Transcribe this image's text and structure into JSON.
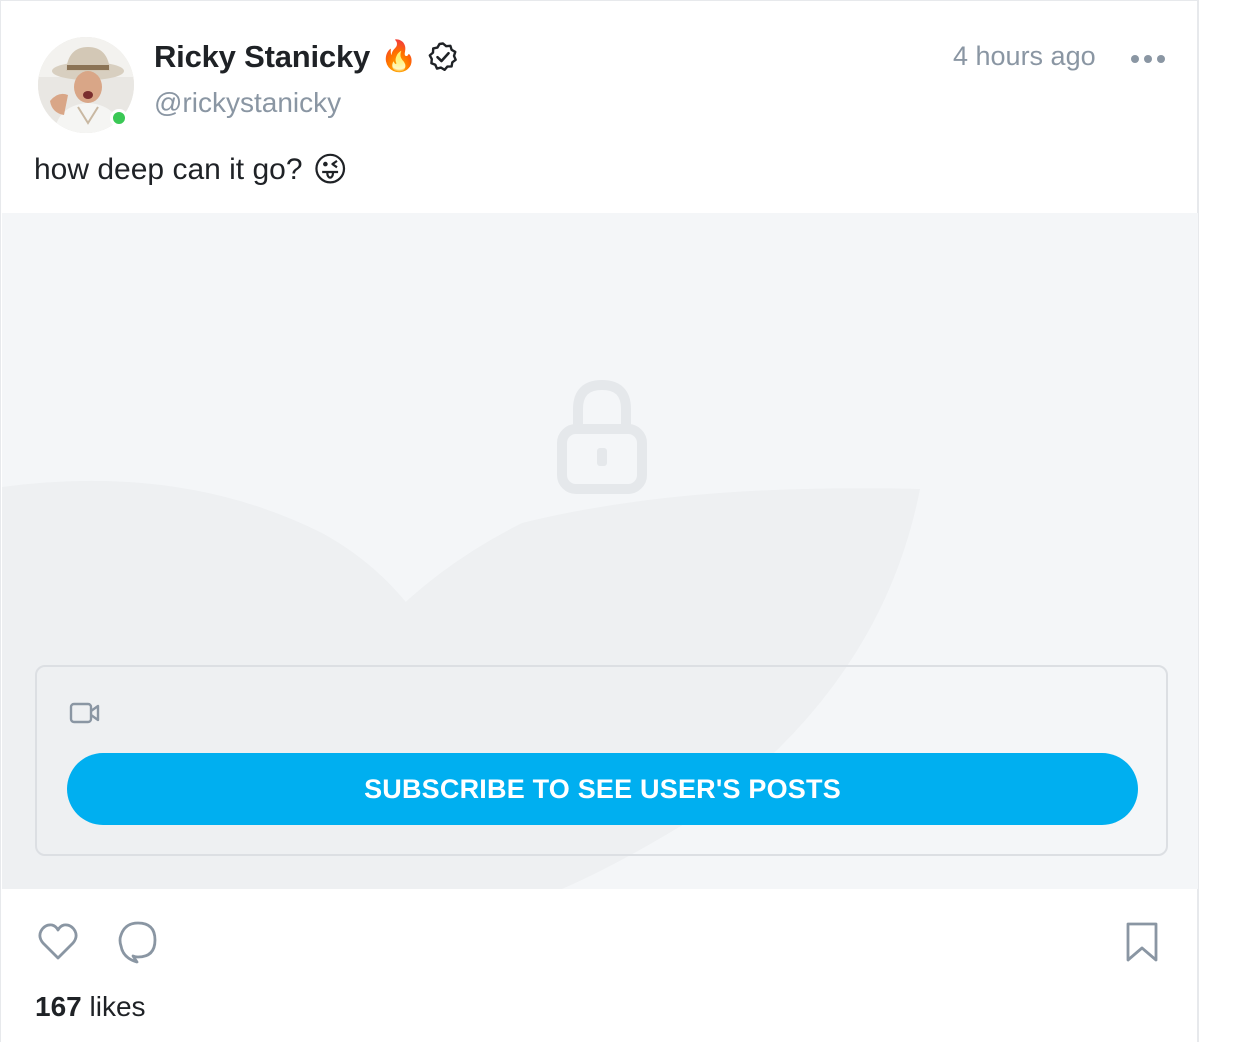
{
  "post": {
    "author_name": "Ricky Stanicky",
    "name_emoji": "🔥",
    "handle": "@rickystanicky",
    "timestamp": "4 hours ago",
    "text": "how deep can it go?",
    "text_emoji": "😜",
    "subscribe_label": "SUBSCRIBE TO SEE USER'S POSTS",
    "likes_count": "167",
    "likes_label": "likes"
  },
  "icons": {
    "verified": "verified-badge-icon",
    "more": "more-dots-icon",
    "lock": "lock-icon",
    "video": "video-camera-icon",
    "like": "heart-icon",
    "comment": "comment-bubble-icon",
    "bookmark": "bookmark-icon"
  },
  "colors": {
    "accent": "#00aff0",
    "online": "#3ac855",
    "muted_text": "#8a96a3",
    "primary_text": "#1f2226"
  },
  "status": {
    "online": true
  }
}
